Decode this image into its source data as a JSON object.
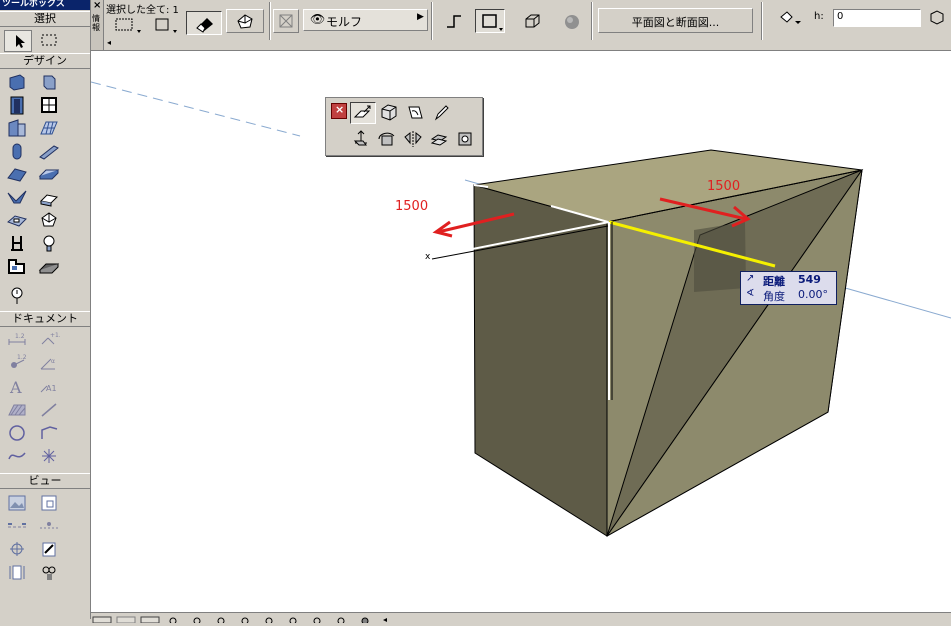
{
  "toolbox": {
    "title": "ツールボックス",
    "sections": {
      "select": "選択",
      "design": "デザイン",
      "document": "ドキュメント",
      "view": "ビュー"
    },
    "design_tools": [
      "wall-icon",
      "column-icon",
      "door-icon",
      "window-icon",
      "curtain-wall-icon",
      "mesh-icon",
      "column-round-icon",
      "beam-icon",
      "roof-icon",
      "slab-icon",
      "shell-icon",
      "stair-icon",
      "skylight-icon",
      "morph-icon",
      "object-icon",
      "lamp-icon",
      "zone-icon",
      "railing-icon",
      "label-marker-icon"
    ],
    "document_tools": [
      "dimension-icon",
      "level-dimension-icon",
      "radial-dimension-icon",
      "angle-dimension-icon",
      "text-icon",
      "label-icon",
      "fill-icon",
      "line-icon",
      "circle-icon",
      "polyline-icon",
      "spline-icon",
      "hotspot-icon"
    ],
    "view_tools": [
      "figure-icon",
      "worksheet-icon",
      "section-icon",
      "elevation-icon",
      "detail-icon",
      "change-marker-icon",
      "interior-elevation-icon",
      "camera-icon"
    ]
  },
  "infobox": {
    "side_label": "情報",
    "selection_text": "選択した全て: 1",
    "geometry_label": "モルフ",
    "floorplan_button": "平面図と断面図...",
    "h_label": "h:",
    "h_value": "0"
  },
  "dimension_labels": {
    "left": "1500",
    "right": "1500"
  },
  "tracker": {
    "distance_label": "距離",
    "distance_value": "549",
    "angle_label": "角度",
    "angle_value": "0.00°"
  },
  "axis_label": "x",
  "colors": {
    "toolbox_title": "#0a246a",
    "box_top": "#aaa580",
    "box_left": "#5e5b47",
    "box_right": "#8d8a6c",
    "highlight": "#f5f000",
    "dim_arrow": "#e02020",
    "tracker_text": "#0a1a7a"
  }
}
